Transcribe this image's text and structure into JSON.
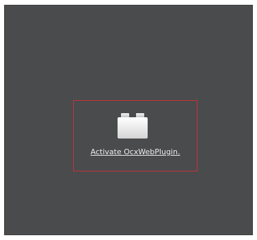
{
  "plugin": {
    "icon": "plugin-brick-icon",
    "activate_label": "Activate OcxWebPlugin."
  },
  "colors": {
    "background": "#4a4b4c",
    "border": "#c8323a",
    "link": "#ececec"
  }
}
